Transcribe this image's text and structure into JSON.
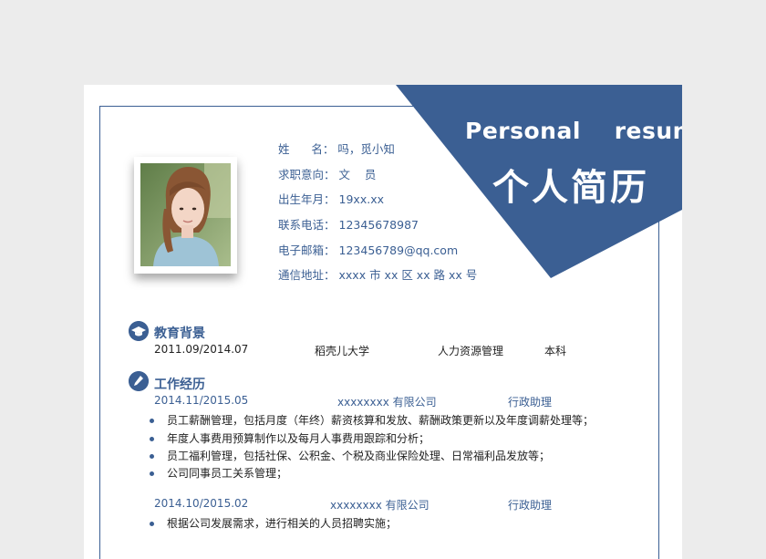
{
  "header": {
    "title_en": "Personal    resume",
    "title_cn": "个人简历"
  },
  "info": [
    {
      "label": "姓      名：",
      "value": "吗，觅小知"
    },
    {
      "label": "求职意向：",
      "value": "文    员"
    },
    {
      "label": "出生年月：",
      "value": "19xx.xx"
    },
    {
      "label": "联系电话：",
      "value": "12345678987"
    },
    {
      "label": "电子邮箱：",
      "value": "123456789@qq.com"
    },
    {
      "label": "通信地址：",
      "value": "xxxx 市 xx 区 xx 路 xx 号"
    }
  ],
  "education": {
    "title": "教育背景",
    "icon": "graduation-cap-icon",
    "period": "2011.09/2014.07",
    "school": "稻壳儿大学",
    "major": "人力资源管理",
    "degree": "本科"
  },
  "work": {
    "title": "工作经历",
    "icon": "pen-icon",
    "jobs": [
      {
        "period": "2014.11/2015.05",
        "company": "xxxxxxxx 有限公司",
        "position": "行政助理",
        "duties": [
          "员工薪酬管理，包括月度（年终）薪资核算和发放、薪酬政策更新以及年度调薪处理等；",
          "年度人事费用预算制作以及每月人事费用跟踪和分析；",
          "员工福利管理，包括社保、公积金、个税及商业保险处理、日常福利品发放等；",
          "公司同事员工关系管理；"
        ]
      },
      {
        "period": "2014.10/2015.02",
        "company": "xxxxxxxx 有限公司",
        "position": "行政助理",
        "duties": [
          "根据公司发展需求，进行相关的人员招聘实施；"
        ]
      }
    ]
  },
  "colors": {
    "accent": "#3b5f93",
    "paper": "#ffffff",
    "background": "#ececec"
  }
}
